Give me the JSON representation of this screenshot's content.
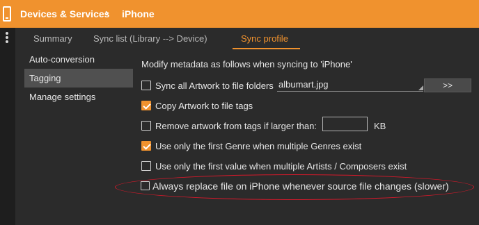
{
  "header": {
    "icon": "phone-icon",
    "breadcrumb": [
      "Devices & Services",
      "iPhone"
    ],
    "separator": "›",
    "accent_color": "#f0922e"
  },
  "tabs": [
    {
      "label": "Summary",
      "active": false
    },
    {
      "label": "Sync list (Library --> Device)",
      "active": false
    },
    {
      "label": "Sync profile",
      "active": true
    }
  ],
  "sidebar": {
    "items": [
      {
        "label": "Auto-conversion",
        "active": false
      },
      {
        "label": "Tagging",
        "active": true
      },
      {
        "label": "Manage settings",
        "active": false
      }
    ]
  },
  "tagging": {
    "heading": "Modify metadata as follows when syncing to 'iPhone'",
    "options": [
      {
        "label": "Sync all Artwork to file folders",
        "checked": false
      },
      {
        "label": "Copy Artwork to file tags",
        "checked": true
      },
      {
        "label": "Remove artwork from tags if larger than:",
        "checked": false
      },
      {
        "label": "Use only the first Genre when multiple Genres exist",
        "checked": true
      },
      {
        "label": "Use only the first value when multiple Artists / Composers exist",
        "checked": false
      },
      {
        "label": "Always replace file on iPhone whenever source file changes (slower)",
        "checked": false
      }
    ],
    "artwork_filename": "albumart.jpg",
    "more_button": ">>",
    "size_value": "",
    "size_unit": "KB",
    "highlight_color": "#d4192b"
  }
}
